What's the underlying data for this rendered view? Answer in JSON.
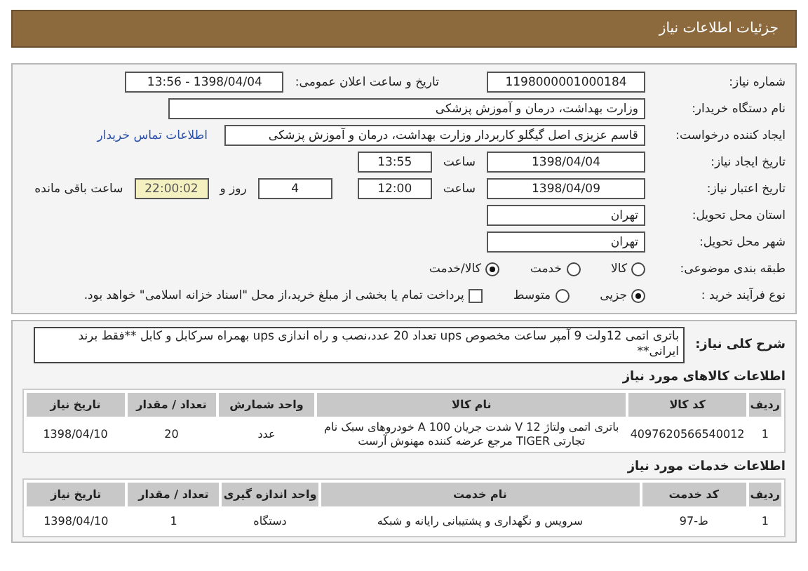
{
  "header": {
    "title": "جزئیات اطلاعات نیاز"
  },
  "need_number": {
    "label": "شماره نیاز:",
    "value": "1198000001000184"
  },
  "announce": {
    "label": "تاریخ و ساعت اعلان عمومی:",
    "value": "1398/04/04 - 13:56"
  },
  "buyer_org": {
    "label": "نام دستگاه خریدار:",
    "value": "وزارت بهداشت، درمان و آموزش پزشکی"
  },
  "requester": {
    "label": "ایجاد کننده درخواست:",
    "value": "قاسم عزیزی اصل گیگلو کاربردار وزارت بهداشت، درمان و آموزش پزشکی",
    "link": "اطلاعات تماس خریدار"
  },
  "created": {
    "label": "تاریخ ایجاد نیاز:",
    "date": "1398/04/04",
    "time_label": "ساعت",
    "time": "13:55"
  },
  "validity": {
    "label": "تاریخ اعتبار نیاز:",
    "date": "1398/04/09",
    "time_label": "ساعت",
    "time": "12:00",
    "days": "4",
    "days_label": "روز و",
    "remaining": "22:00:02",
    "remaining_label": "ساعت باقی مانده"
  },
  "province": {
    "label": "استان محل تحویل:",
    "value": "تهران"
  },
  "city": {
    "label": "شهر محل تحویل:",
    "value": "تهران"
  },
  "category": {
    "label": "طبقه بندی موضوعی:",
    "options": [
      {
        "label": "کالا",
        "selected": false
      },
      {
        "label": "خدمت",
        "selected": false
      },
      {
        "label": "کالا/خدمت",
        "selected": true
      }
    ]
  },
  "purchase_type": {
    "label": "نوع فرآیند خرید :",
    "options": [
      {
        "label": "جزیی",
        "selected": true
      },
      {
        "label": "متوسط",
        "selected": false
      }
    ],
    "payment": {
      "label": "پرداخت تمام یا بخشی از مبلغ خرید،از محل \"اسناد خزانه اسلامی\" خواهد بود.",
      "checked": false
    }
  },
  "description": {
    "label": "شرح کلی نیاز:",
    "text": "باتری اتمی 12ولت 9 آمپر ساعت مخصوص ups تعداد 20 عدد،نصب و راه اندازی ups بهمراه سرکابل و کابل **فقط برند ایرانی**"
  },
  "goods": {
    "title": "اطلاعات کالاهای مورد نیاز",
    "columns": [
      "ردیف",
      "کد کالا",
      "نام کالا",
      "واحد شمارش",
      "تعداد / مقدار",
      "تاریخ نیاز"
    ],
    "rows": [
      [
        "1",
        "4097620566540012",
        "باتری اتمی ولتاژ 12 V شدت جریان 100 A خودروهای سبک نام تجارتی TIGER مرجع عرضه کننده مهنوش آرست",
        "عدد",
        "20",
        "1398/04/10"
      ]
    ]
  },
  "services": {
    "title": "اطلاعات خدمات مورد نیاز",
    "columns": [
      "ردیف",
      "کد خدمت",
      "نام خدمت",
      "واحد اندازه گیری",
      "تعداد / مقدار",
      "تاریخ نیاز"
    ],
    "rows": [
      [
        "1",
        "ط-97",
        "سرویس و نگهداری و پشتیبانی رایانه و شبکه",
        "دستگاه",
        "1",
        "1398/04/10"
      ]
    ]
  }
}
